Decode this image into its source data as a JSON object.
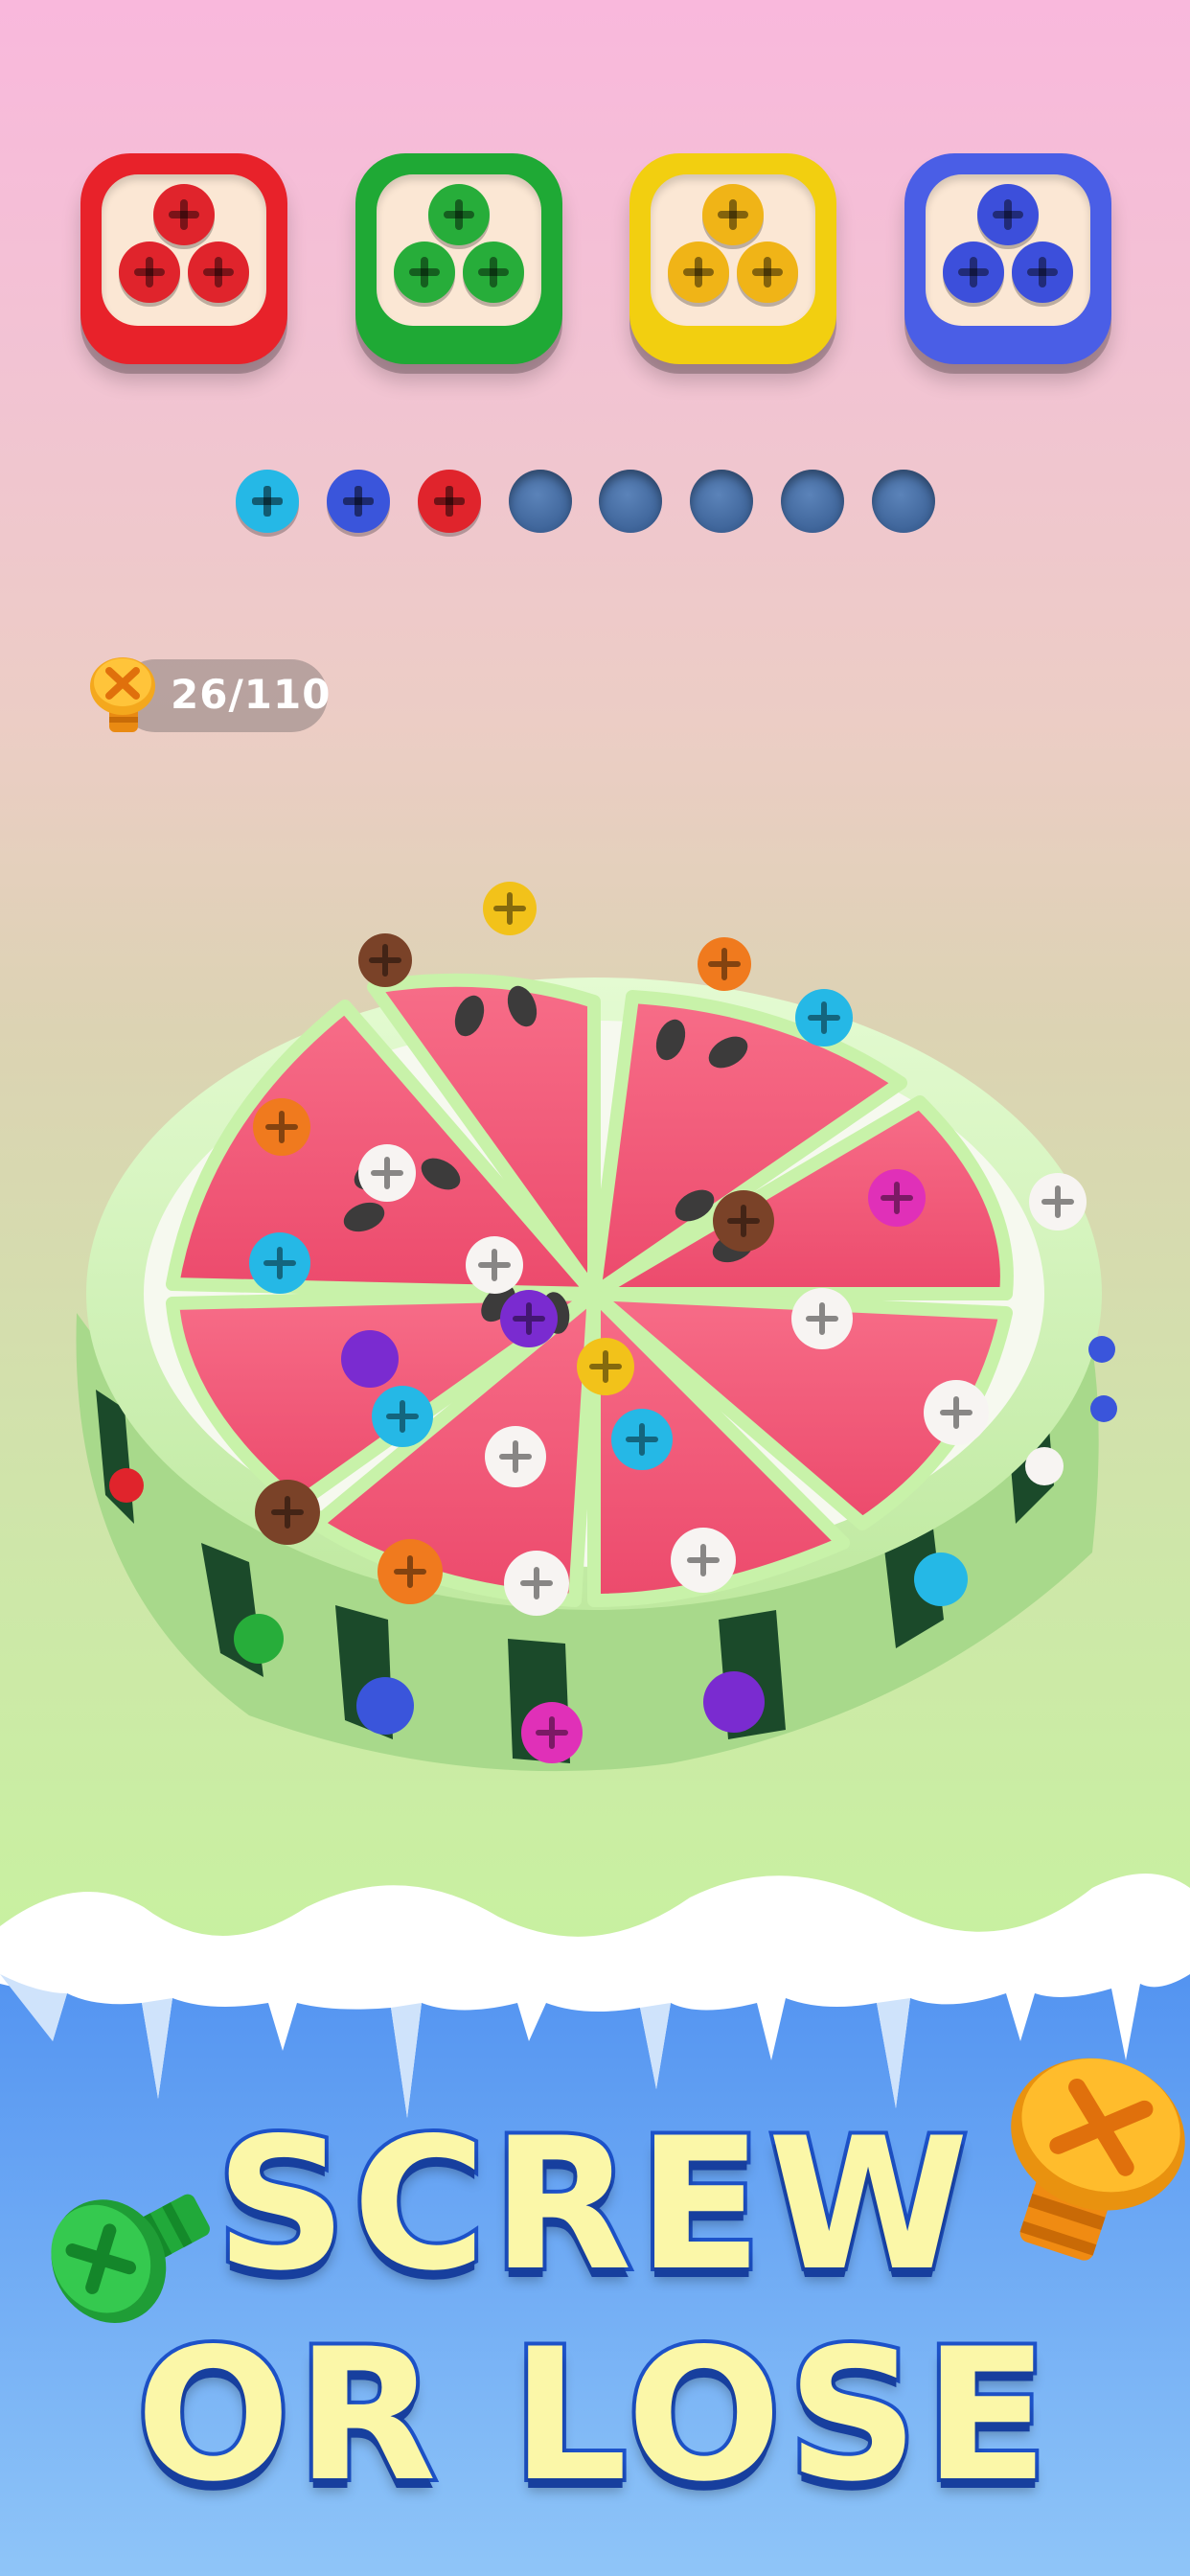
{
  "color_boxes": [
    {
      "name": "red",
      "frame": "#e8222a",
      "screw": "#e0242c"
    },
    {
      "name": "green",
      "frame": "#1fa935",
      "screw": "#27ad3a"
    },
    {
      "name": "yellow",
      "frame": "#f2cf10",
      "screw": "#f0b417"
    },
    {
      "name": "blue",
      "frame": "#4a5ee6",
      "screw": "#3c4fdb"
    }
  ],
  "slots": [
    {
      "state": "filled",
      "color": "#25b8e6"
    },
    {
      "state": "filled",
      "color": "#3a55db"
    },
    {
      "state": "filled",
      "color": "#e0242c"
    },
    {
      "state": "empty"
    },
    {
      "state": "empty"
    },
    {
      "state": "empty"
    },
    {
      "state": "empty"
    },
    {
      "state": "empty"
    }
  ],
  "counter": {
    "text": "26/110",
    "icon": "orange-screw-icon"
  },
  "title": {
    "line1": "SCREW",
    "line2": "OR LOSE"
  },
  "colors": {
    "melon_flesh": "#f4607c",
    "melon_rind": "#c8f2a9",
    "melon_white": "#f5f9ee",
    "melon_stripe": "#1b4a2a",
    "snow": "#ffffff",
    "sky_blue": "#4a8ff0"
  }
}
